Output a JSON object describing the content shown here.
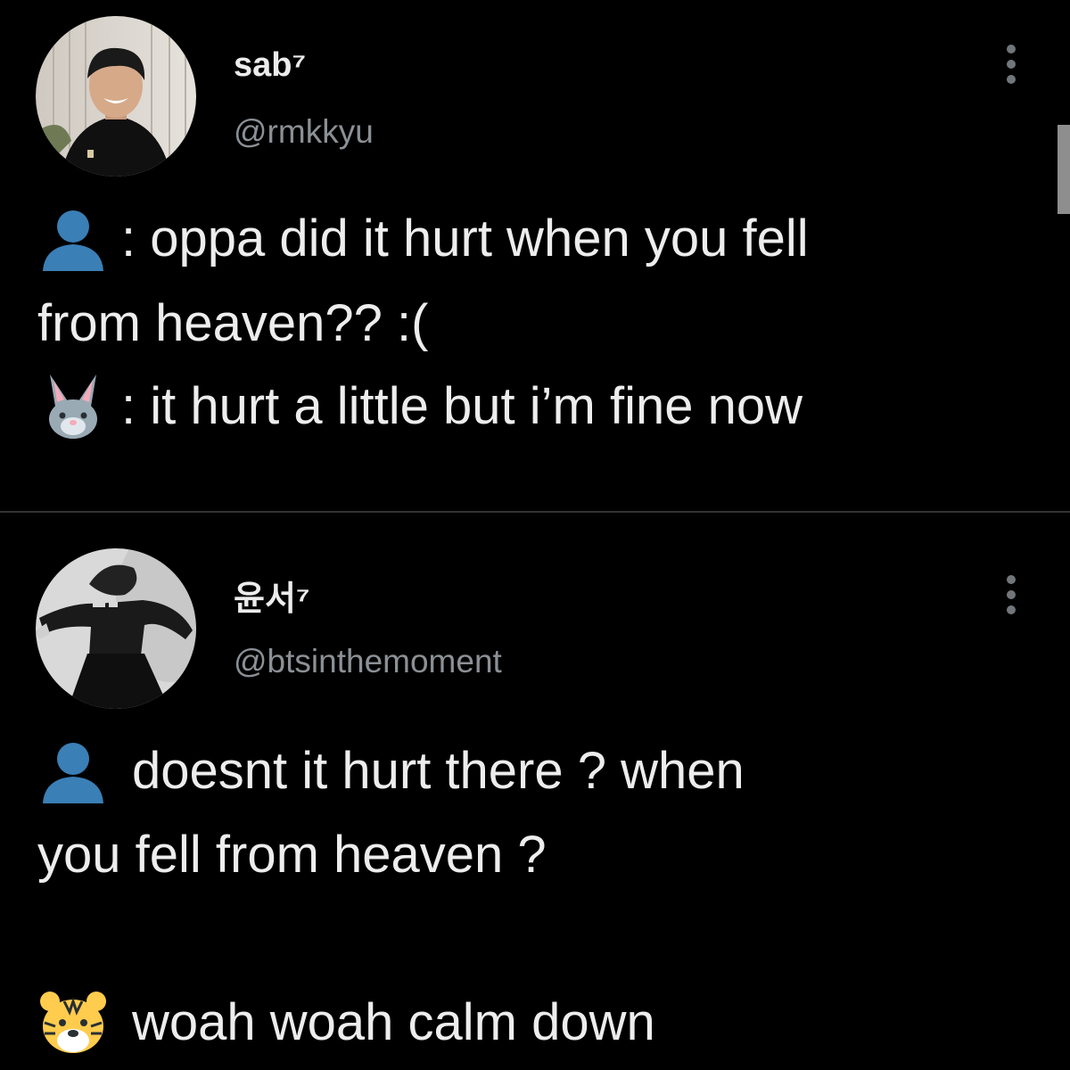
{
  "tweets": [
    {
      "display_name": "sab⁷",
      "handle": "@rmkkyu",
      "lines": [
        ": oppa did it hurt when you fell",
        "from heaven?? :(",
        ": it hurt a little but i’m fine now"
      ]
    },
    {
      "display_name": "윤서⁷",
      "handle": "@btsinthemoment",
      "lines": [
        "doesnt it hurt there ? when",
        "you fell from heaven ?",
        "woah woah calm down"
      ]
    }
  ],
  "colors": {
    "background": "#000000",
    "primary_text": "#e7e9ea",
    "secondary_text": "#8b9095",
    "divider": "#2f3336",
    "person_emoji": "#3a7fb6"
  },
  "icons": {
    "more": "more-vertical-icon",
    "person": "bust-in-silhouette-icon",
    "rabbit": "rabbit-face-icon",
    "tiger": "tiger-face-icon"
  }
}
